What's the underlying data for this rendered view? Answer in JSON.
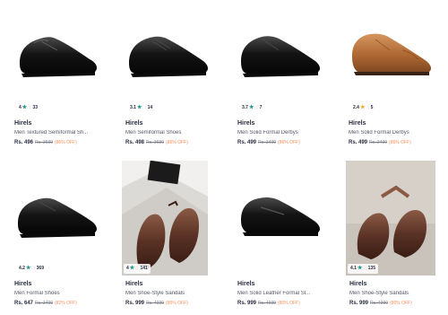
{
  "colors": {
    "star_green": "#14958f",
    "star_yellow": "#f5a623",
    "discount": "#ff905a",
    "text": "#282c3f"
  },
  "products": [
    {
      "brand": "Hirels",
      "name": "Men Textured Semiformal Sh...",
      "price": "Rs. 496",
      "mrp": "Rs. 3699",
      "discount": "(86% OFF)",
      "rating": "4",
      "star": "★",
      "star_color": "green",
      "rating_count": "33"
    },
    {
      "brand": "Hirels",
      "name": "Men Semiformal Shoes",
      "price": "Rs. 498",
      "mrp": "Rs. 3699",
      "discount": "(86% OFF)",
      "rating": "3.1",
      "star": "★",
      "star_color": "green",
      "rating_count": "14"
    },
    {
      "brand": "Hirels",
      "name": "Men Solid Formal Derbys",
      "price": "Rs. 499",
      "mrp": "Rs. 3499",
      "discount": "(86% OFF)",
      "rating": "3.7",
      "star": "★",
      "star_color": "green",
      "rating_count": "7"
    },
    {
      "brand": "Hirels",
      "name": "Men Solid Formal Derbys",
      "price": "Rs. 499",
      "mrp": "Rs. 3499",
      "discount": "(86% OFF)",
      "rating": "2.4",
      "star": "★",
      "star_color": "yellow",
      "rating_count": "5"
    },
    {
      "brand": "Hirels",
      "name": "Men Formal Shoes",
      "price": "Rs. 647",
      "mrp": "Rs. 3499",
      "discount": "(82% OFF)",
      "rating": "4.2",
      "star": "★",
      "star_color": "green",
      "rating_count": "369"
    },
    {
      "brand": "Hirels",
      "name": "Men Shoe-Style Sandals",
      "price": "Rs. 999",
      "mrp": "Rs. 4999",
      "discount": "(80% OFF)",
      "rating": "4",
      "star": "★",
      "star_color": "green",
      "rating_count": "141"
    },
    {
      "brand": "Hirels",
      "name": "Men Solid Leather Formal Sl...",
      "price": "Rs. 999",
      "mrp": "Rs. 4999",
      "discount": "(80% OFF)"
    },
    {
      "brand": "Hirels",
      "name": "Men Shoe-Style Sandals",
      "price": "Rs. 999",
      "mrp": "Rs. 4999",
      "discount": "(80% OFF)",
      "rating": "4.1",
      "star": "★",
      "star_color": "green",
      "rating_count": "135"
    }
  ]
}
